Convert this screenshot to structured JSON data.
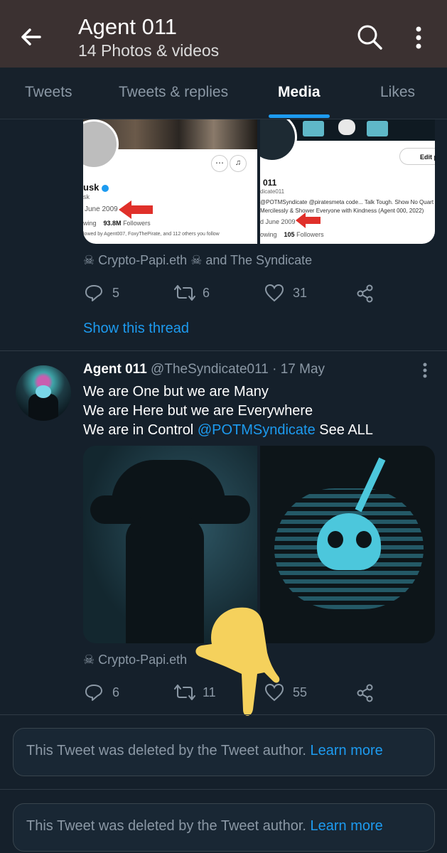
{
  "header": {
    "title": "Agent 011",
    "subtitle": "14 Photos & videos"
  },
  "tabs": [
    {
      "label": "Tweets"
    },
    {
      "label": "Tweets & replies"
    },
    {
      "label": "Media"
    },
    {
      "label": "Likes"
    }
  ],
  "embedded_left": {
    "name_fragment": "usk",
    "handle_fragment": "sk",
    "joined": "June 2009",
    "following_fragment": "wing",
    "followers_count": "93.8M",
    "followers_label": "Followers",
    "followed_by": "lowed by Agent007, FoxyThePirate, and 112 others you follow"
  },
  "embedded_right": {
    "name_fragment": "011",
    "handle_fragment": "dicate011",
    "edit_label": "Edit p",
    "bio_fragment": "@POTMSyndicate @piratesmeta code... Talk Tough. Show No Quart Mercilessly & Shower Everyone with Kindness (Agent 000, 2022)",
    "joined": "d June 2009",
    "following_fragment": "owing",
    "followers_count": "105",
    "followers_label": "Followers"
  },
  "tweet1": {
    "liked_by": "☠ Crypto-Papi.eth ☠ and The Syndicate",
    "replies": "5",
    "retweets": "6",
    "likes": "31",
    "show_thread": "Show this thread"
  },
  "tweet2": {
    "name": "Agent 011",
    "handle": "@TheSyndicate011",
    "date": "· 17 May",
    "line1": "We are One but we are Many",
    "line2": "We are Here but we are Everywhere",
    "line3_prefix": "We are in Control ",
    "mention": "@POTMSyndicate",
    "line3_suffix": " See ALL",
    "liked_by": "☠ Crypto-Papi.eth",
    "replies": "6",
    "retweets": "11",
    "likes": "55"
  },
  "deleted": [
    {
      "text": "This Tweet was deleted by the Tweet author.",
      "link": "Learn more"
    },
    {
      "text": "This Tweet was deleted by the Tweet author.",
      "link": "Learn more"
    }
  ],
  "colors": {
    "header_bg": "#3b3131",
    "page_bg": "#15202b",
    "accent": "#1d9bf0",
    "arrow_red": "#e0302a",
    "hand_yellow": "#f5d15c"
  }
}
